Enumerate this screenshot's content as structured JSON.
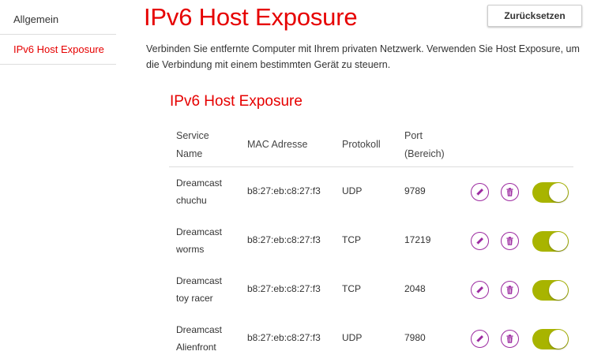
{
  "sidebar": {
    "items": [
      {
        "label": "Allgemein"
      },
      {
        "label": "IPv6 Host Exposure",
        "active": true
      }
    ]
  },
  "header": {
    "title": "IPv6 Host Exposure",
    "reset_label": "Zurücksetzen",
    "description": "Verbinden Sie entfernte Computer mit Ihrem privaten Netzwerk. Verwenden Sie Host Exposure, um die Verbindung mit einem bestimmten Gerät zu steuern."
  },
  "section": {
    "title": "IPv6 Host Exposure",
    "columns": {
      "service_1": "Service",
      "service_2": "Name",
      "mac": "MAC Adresse",
      "protocol": "Protokoll",
      "port_1": "Port",
      "port_2": "(Bereich)"
    },
    "rows": [
      {
        "name_1": "Dreamcast",
        "name_2": "chuchu",
        "mac": "b8:27:eb:c8:27:f3",
        "protocol": "UDP",
        "port": "9789",
        "enabled": true
      },
      {
        "name_1": "Dreamcast",
        "name_2": "worms",
        "mac": "b8:27:eb:c8:27:f3",
        "protocol": "TCP",
        "port": "17219",
        "enabled": true
      },
      {
        "name_1": "Dreamcast",
        "name_2": "toy racer",
        "mac": "b8:27:eb:c8:27:f3",
        "protocol": "TCP",
        "port": "2048",
        "enabled": true
      },
      {
        "name_1": "Dreamcast",
        "name_2": "Alienfront",
        "mac": "b8:27:eb:c8:27:f3",
        "protocol": "UDP",
        "port": "7980",
        "enabled": true
      }
    ]
  },
  "colors": {
    "brand_red": "#e60000",
    "icon_purple": "#9c2aa0",
    "toggle_on": "#a8b400"
  },
  "icons": [
    "pencil-icon",
    "trash-icon"
  ]
}
